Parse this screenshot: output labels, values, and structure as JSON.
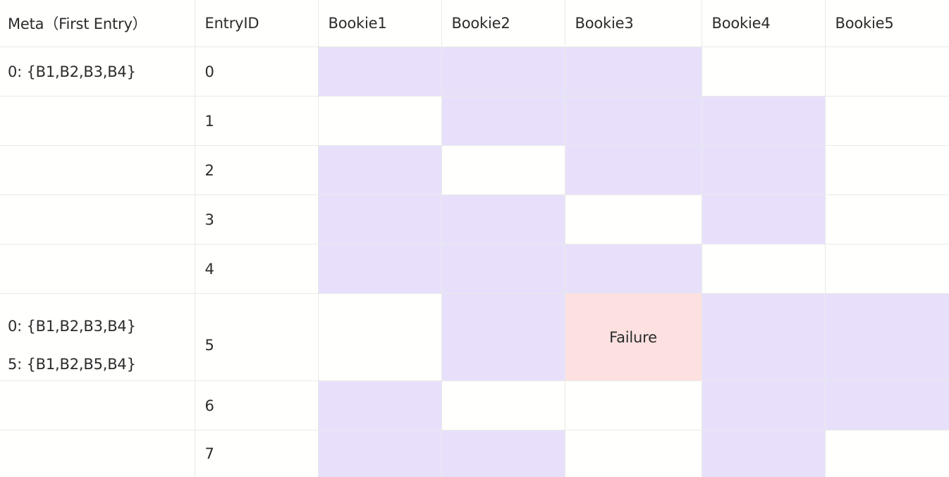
{
  "headers": [
    "Meta（First Entry）",
    "EntryID",
    "Bookie1",
    "Bookie2",
    "Bookie3",
    "Bookie4",
    "Bookie5"
  ],
  "rows": [
    {
      "meta": [
        "0: {B1,B2,B3,B4}"
      ],
      "entry_id": "0",
      "bookies": [
        "written",
        "written",
        "written",
        "empty",
        "empty"
      ]
    },
    {
      "meta": [],
      "entry_id": "1",
      "bookies": [
        "empty",
        "written",
        "written",
        "written",
        "empty"
      ]
    },
    {
      "meta": [],
      "entry_id": "2",
      "bookies": [
        "written",
        "empty",
        "written",
        "written",
        "empty"
      ]
    },
    {
      "meta": [],
      "entry_id": "3",
      "bookies": [
        "written",
        "written",
        "empty",
        "written",
        "empty"
      ]
    },
    {
      "meta": [],
      "entry_id": "4",
      "bookies": [
        "written",
        "written",
        "written",
        "empty",
        "empty"
      ]
    },
    {
      "meta": [
        "0: {B1,B2,B3,B4}",
        "5:  {B1,B2,B5,B4}"
      ],
      "entry_id": "5",
      "bookies": [
        "empty",
        "written",
        "failure",
        "written",
        "written"
      ]
    },
    {
      "meta": [],
      "entry_id": "6",
      "bookies": [
        "written",
        "empty",
        "empty",
        "written",
        "written"
      ]
    },
    {
      "meta": [],
      "entry_id": "7",
      "bookies": [
        "written",
        "written",
        "empty",
        "written",
        "empty"
      ]
    }
  ],
  "failure_label": "Failure",
  "colors": {
    "written": "#e8e0fb",
    "failure": "#fde0e0",
    "empty": "#fffffd",
    "border": "#e9e9e7"
  }
}
